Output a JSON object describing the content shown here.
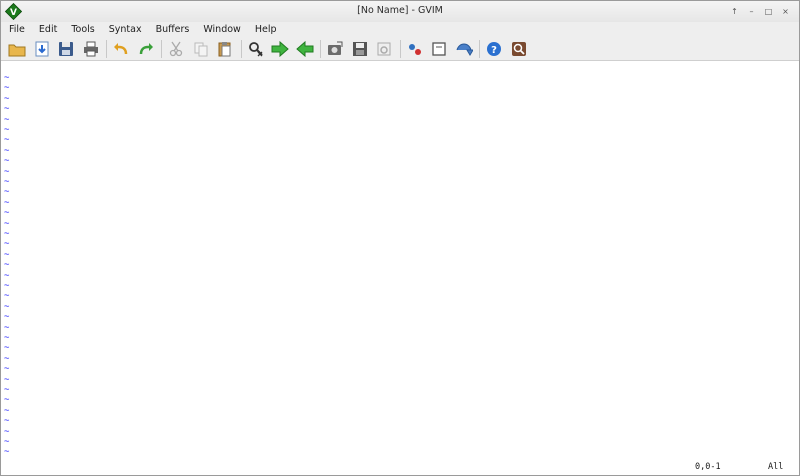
{
  "window": {
    "title": "[No Name] - GVIM",
    "controls": [
      "↑",
      "–",
      "□",
      "×"
    ]
  },
  "menu": [
    "File",
    "Edit",
    "Tools",
    "Syntax",
    "Buffers",
    "Window",
    "Help"
  ],
  "toolbar": [
    {
      "icon": "open-folder-icon"
    },
    {
      "icon": "save-down-arrow-icon"
    },
    {
      "icon": "save-disk-icon"
    },
    {
      "icon": "print-icon"
    },
    {
      "sep": true
    },
    {
      "icon": "undo-icon"
    },
    {
      "icon": "redo-icon"
    },
    {
      "sep": true
    },
    {
      "icon": "cut-icon"
    },
    {
      "icon": "copy-icon"
    },
    {
      "icon": "paste-icon"
    },
    {
      "sep": true
    },
    {
      "icon": "find-replace-icon"
    },
    {
      "icon": "find-next-icon"
    },
    {
      "icon": "find-previous-icon"
    },
    {
      "sep": true
    },
    {
      "icon": "load-session-icon"
    },
    {
      "icon": "save-session-icon"
    },
    {
      "icon": "run-script-icon"
    },
    {
      "sep": true
    },
    {
      "icon": "make-icon"
    },
    {
      "icon": "shell-icon"
    },
    {
      "icon": "run-ctags-icon"
    },
    {
      "sep": true
    },
    {
      "icon": "help-icon"
    },
    {
      "icon": "find-help-icon"
    }
  ],
  "editor": {
    "empty_line_marker": "~",
    "empty_line_count": 37
  },
  "status": {
    "position": "0,0-1",
    "scroll": "All"
  },
  "colors": {
    "tilde": "#2a2aff",
    "chrome": "#eeeeee"
  }
}
